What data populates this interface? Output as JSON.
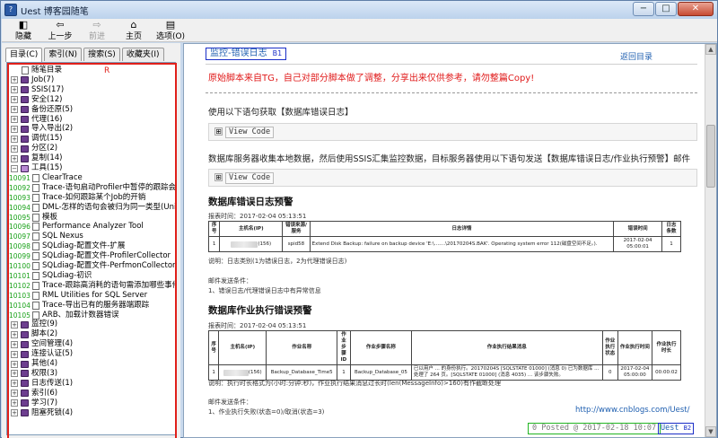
{
  "window": {
    "title": "Uest 博客园随笔",
    "buttons": {
      "minimize": "−",
      "maximize": "□",
      "close": "✕"
    }
  },
  "toolbar": {
    "items": [
      {
        "label": "隐藏",
        "icon": "hide-icon",
        "glyph": "◧",
        "enabled": true
      },
      {
        "label": "上一步",
        "icon": "back-arrow-icon",
        "glyph": "⇦",
        "enabled": true
      },
      {
        "label": "前进",
        "icon": "forward-arrow-icon",
        "glyph": "⇨",
        "enabled": false
      },
      {
        "label": "主页",
        "icon": "home-icon",
        "glyph": "⌂",
        "enabled": true
      },
      {
        "label": "选项(O)",
        "icon": "options-icon",
        "glyph": "▤",
        "enabled": true
      }
    ]
  },
  "left": {
    "tabs": [
      "目录(C)",
      "索引(N)",
      "搜索(S)",
      "收藏夹(I)"
    ],
    "active_tab": 0,
    "red_label": "R",
    "tree": [
      {
        "type": "page",
        "label": "随笔目录",
        "indent": 1
      },
      {
        "type": "book",
        "label": "Job(7)"
      },
      {
        "type": "book",
        "label": "SSIS(17)"
      },
      {
        "type": "book",
        "label": "安全(12)"
      },
      {
        "type": "book",
        "label": "备份还原(5)"
      },
      {
        "type": "book",
        "label": "代理(16)"
      },
      {
        "type": "book",
        "label": "导入导出(2)"
      },
      {
        "type": "book",
        "label": "调优(15)"
      },
      {
        "type": "book",
        "label": "分区(2)"
      },
      {
        "type": "book",
        "label": "复制(14)"
      },
      {
        "type": "book",
        "label": "工具(15)",
        "open": true
      },
      {
        "type": "item",
        "num": "10091",
        "label": "ClearTrace"
      },
      {
        "type": "item",
        "num": "10092",
        "label": "Trace-语句启动Profiler中暂停的跟踪会话"
      },
      {
        "type": "item",
        "num": "10093",
        "label": "Trace-如何跟踪某个Job的开销"
      },
      {
        "type": "item",
        "num": "10094",
        "label": "DML-怎样的语句会被归为同一类型(Uni"
      },
      {
        "type": "item",
        "num": "10095",
        "label": "模板"
      },
      {
        "type": "item",
        "num": "10096",
        "label": "Performance Analyzer Tool"
      },
      {
        "type": "item",
        "num": "10097",
        "label": "SQL Nexus"
      },
      {
        "type": "item",
        "num": "10098",
        "label": "SQLdiag-配置文件-扩展"
      },
      {
        "type": "item",
        "num": "10099",
        "label": "SQLdiag-配置文件-ProfilerCollector"
      },
      {
        "type": "item",
        "num": "10100",
        "label": "SQLdiag-配置文件-PerfmonCollector"
      },
      {
        "type": "item",
        "num": "10101",
        "label": "SQLdiag-初识"
      },
      {
        "type": "item",
        "num": "10102",
        "label": "Trace-跟踪高消耗的语句需添加哪些事件"
      },
      {
        "type": "item",
        "num": "10103",
        "label": "RML Utilities for SQL Server"
      },
      {
        "type": "item",
        "num": "10104",
        "label": "Trace-导出已有的服务器端跟踪"
      },
      {
        "type": "item",
        "num": "10105",
        "label": "ARB、加载计数器错误"
      },
      {
        "type": "book",
        "label": "监控(9)"
      },
      {
        "type": "book",
        "label": "脚本(2)"
      },
      {
        "type": "book",
        "label": "空间管理(4)"
      },
      {
        "type": "book",
        "label": "连接认证(5)"
      },
      {
        "type": "book",
        "label": "其他(4)"
      },
      {
        "type": "book",
        "label": "权限(3)"
      },
      {
        "type": "book",
        "label": "日志传送(1)"
      },
      {
        "type": "book",
        "label": "索引(6)"
      },
      {
        "type": "book",
        "label": "学习(7)"
      },
      {
        "type": "book",
        "label": "阻塞死锁(4)"
      }
    ]
  },
  "content": {
    "title": "监控-错误日志",
    "title_tag": "B1",
    "back_link": "返回目录",
    "notice": "原始脚本来自TG，自己对部分脚本做了调整，分享出来仅供参考，请勿整篇Copy!",
    "para1": "使用以下语句获取【数据库错误日志】",
    "view_code": "View Code",
    "para2": "数据库服务器收集本地数据，然后使用SSIS汇集监控数据，目标服务器使用以下语句发送【数据库错误日志/作业执行预警】邮件",
    "section1": {
      "heading": "数据库错误日志预警",
      "report_time": "报表时间：2017-02-04 05:13:51",
      "headers": [
        "序号",
        "主机名(IP)",
        "错误来源/服务",
        "日志详情",
        "错误时间",
        "日志条数"
      ],
      "row": {
        "seq": "1",
        "host": "(156)",
        "source": "spid58",
        "detail": "Extend Disk Backup: failure on backup device 'E:\\.......\\20170204S.BAK'. Operating system error 112(磁盘空间不足。).",
        "time": "2017-02-04 05:00:01",
        "count": "1"
      },
      "note": "说明：日志类别(1为错误日志，2为代理错误日志)",
      "mail_label": "邮件发送条件：",
      "mail_cond": "1、错误日志/代理错误日志中有异常信息"
    },
    "section2": {
      "heading": "数据库作业执行错误预警",
      "report_time": "报表时间：2017-02-04 05:13:51",
      "headers": [
        "序号",
        "主机名(IP)",
        "作业名称",
        "作业步骤ID",
        "作业步骤名称",
        "作业执行结果消息",
        "作业执行状态",
        "作业执行时间",
        "作业执行时长"
      ],
      "row": {
        "seq": "1",
        "host": "(156)",
        "job": "Backup_Database_Time5",
        "step_id": "1",
        "step_name": "Backup_Database_05",
        "message": "已以用户 ... 的身份执行。20170204S [SQLSTATE 01000] (消息 0) 已为数据库 ... 处理了 264 页。[SQLSTATE 01000] (消息 4035) ... 该步骤失败。",
        "status": "0",
        "run_time": "2017-02-04 05:00:00",
        "duration": "00:00:02"
      },
      "note": "说明：执行时长格式为(小时:分钟:秒)，作业执行结果消息过长时(len(MessageInfo)>160)有作截断处理",
      "mail_label": "邮件发送条件：",
      "mail_cond": "1、作业执行失败(状态=0)/取消(状态=3)"
    },
    "footer_link": "http://www.cnblogs.com/Uest/",
    "posted": "0  Posted @ 2017-02-18 10:07",
    "author": "Uest",
    "author_tag": "B2"
  }
}
